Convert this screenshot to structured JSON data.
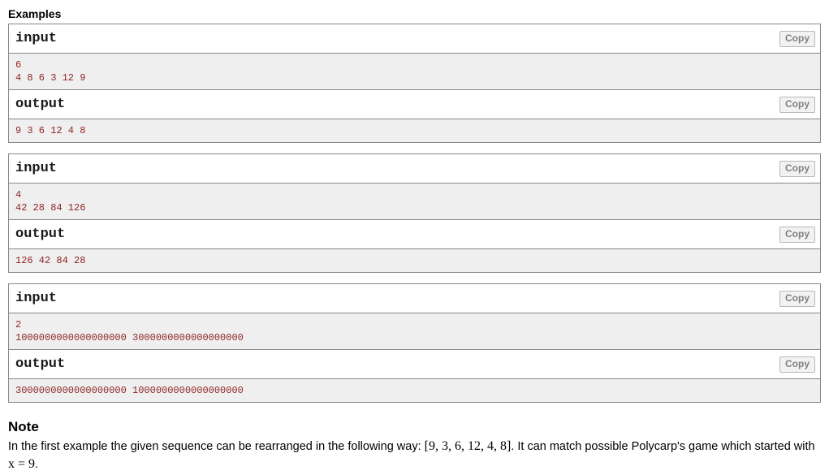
{
  "examples": {
    "heading": "Examples",
    "copy_label": "Copy",
    "input_label": "input",
    "output_label": "output",
    "tests": [
      {
        "input_lines": [
          "6",
          "4 8 6 3 12 9"
        ],
        "output_lines": [
          "9 3 6 12 4 8"
        ]
      },
      {
        "input_lines": [
          "4",
          "42 28 84 126"
        ],
        "output_lines": [
          "126 42 84 28"
        ]
      },
      {
        "input_lines": [
          "2",
          "1000000000000000000 3000000000000000000"
        ],
        "output_lines": [
          "3000000000000000000 1000000000000000000"
        ]
      }
    ]
  },
  "note": {
    "heading": "Note",
    "text_part1": "In the first example the given sequence can be rearranged in the following way: ",
    "math_sequence": "[9, 3, 6, 12, 4, 8]",
    "text_part2": ". It can match possible Polycarp's game which started with ",
    "math_x": "x = 9",
    "text_part3": "."
  }
}
